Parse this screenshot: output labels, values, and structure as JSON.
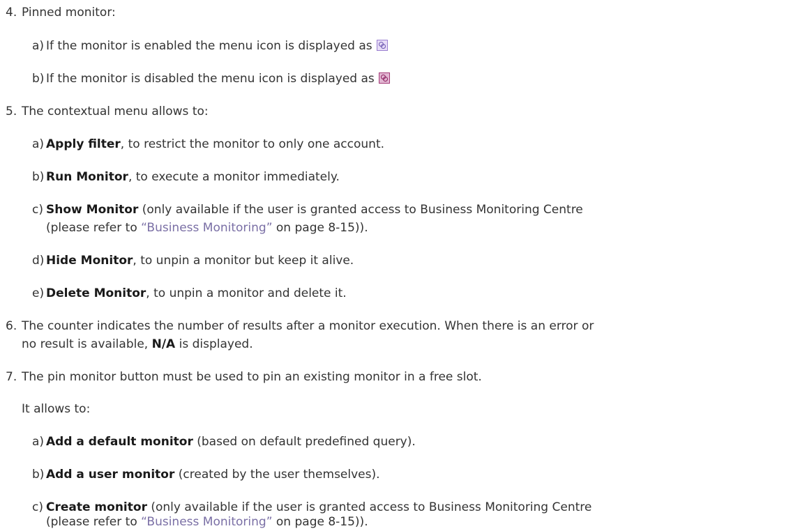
{
  "items": [
    {
      "num": "4.",
      "text": "Pinned monitor:"
    },
    {
      "num": "5.",
      "text": "The contextual menu allows to:"
    },
    {
      "num": "6.",
      "text": "The counter indicates the number of results after a monitor execution. When there is an error or",
      "text2_pre": "no result is available, ",
      "text2_bold": "N/A",
      "text2_post": " is displayed."
    },
    {
      "num": "7.",
      "text": "The pin monitor button must be used to pin an existing monitor in a free slot.",
      "text2": "It allows to:"
    }
  ],
  "item4_subs": [
    {
      "letter": "a)",
      "text": "If the monitor is enabled the menu icon is displayed as",
      "icon": "monitor-enabled-icon"
    },
    {
      "letter": "b)",
      "text": "If the monitor is disabled the menu icon is displayed as",
      "icon": "monitor-disabled-icon"
    }
  ],
  "item5_subs": [
    {
      "letter": "a)",
      "bold": "Apply filter",
      "rest": ", to restrict the monitor to only one account."
    },
    {
      "letter": "b)",
      "bold": "Run Monitor",
      "rest": ", to execute a monitor immediately."
    },
    {
      "letter": "c)",
      "bold": "Show Monitor",
      "rest": " (only available if the user is granted access to Business Monitoring Centre",
      "line2_pre": "(please refer to ",
      "link": "“Business Monitoring”",
      "line2_post": " on page 8-15))."
    },
    {
      "letter": "d)",
      "bold": "Hide Monitor",
      "rest": ", to unpin a monitor but keep it alive."
    },
    {
      "letter": "e)",
      "bold": "Delete Monitor",
      "rest": ", to unpin a monitor and delete it."
    }
  ],
  "item7_subs": [
    {
      "letter": "a)",
      "bold": "Add a default monitor",
      "rest": " (based on default predefined query)."
    },
    {
      "letter": "b)",
      "bold": "Add a user monitor",
      "rest": " (created by the user themselves)."
    },
    {
      "letter": "c)",
      "bold": "Create monitor",
      "rest": " (only available if the user is granted access to Business Monitoring Centre",
      "line2_pre": "(please refer to ",
      "link": "“Business Monitoring”",
      "line2_post": " on page 8-15))."
    }
  ],
  "colors": {
    "text": "#333333",
    "link": "#7a6fa5",
    "icon_enabled": "#e7dcf7",
    "icon_disabled": "#e2b6d2"
  }
}
